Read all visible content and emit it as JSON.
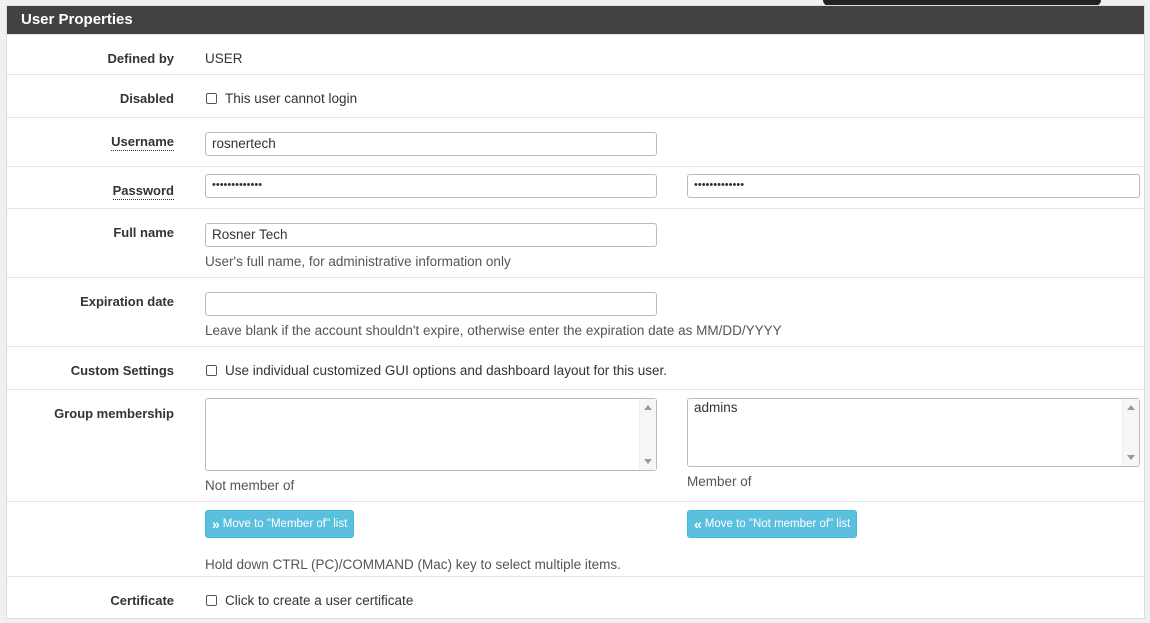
{
  "panel": {
    "title": "User Properties"
  },
  "defined_by": {
    "label": "Defined by",
    "value": "USER"
  },
  "disabled": {
    "label": "Disabled",
    "checkbox_label": "This user cannot login",
    "checked": false
  },
  "username": {
    "label": "Username",
    "value": "rosnertech"
  },
  "password": {
    "label": "Password",
    "value": "•••••••••••••",
    "confirm_value": "•••••••••••••"
  },
  "full_name": {
    "label": "Full name",
    "value": "Rosner Tech",
    "help": "User's full name, for administrative information only"
  },
  "expiration": {
    "label": "Expiration date",
    "value": "",
    "help": "Leave blank if the account shouldn't expire, otherwise enter the expiration date as MM/DD/YYYY"
  },
  "custom_settings": {
    "label": "Custom Settings",
    "checkbox_label": "Use individual customized GUI options and dashboard layout for this user.",
    "checked": false
  },
  "group_membership": {
    "label": "Group membership",
    "not_member_items": [],
    "not_member_caption": "Not member of",
    "member_items": [
      "admins"
    ],
    "member_caption": "Member of",
    "move_to_member_label": "Move to \"Member of\" list",
    "move_to_not_member_label": "Move to \"Not member of\" list",
    "help": "Hold down CTRL (PC)/COMMAND (Mac) key to select multiple items."
  },
  "certificate": {
    "label": "Certificate",
    "checkbox_label": "Click to create a user certificate",
    "checked": false
  },
  "colors": {
    "heading_bg": "#424242",
    "button_bg": "#5bc0de"
  }
}
